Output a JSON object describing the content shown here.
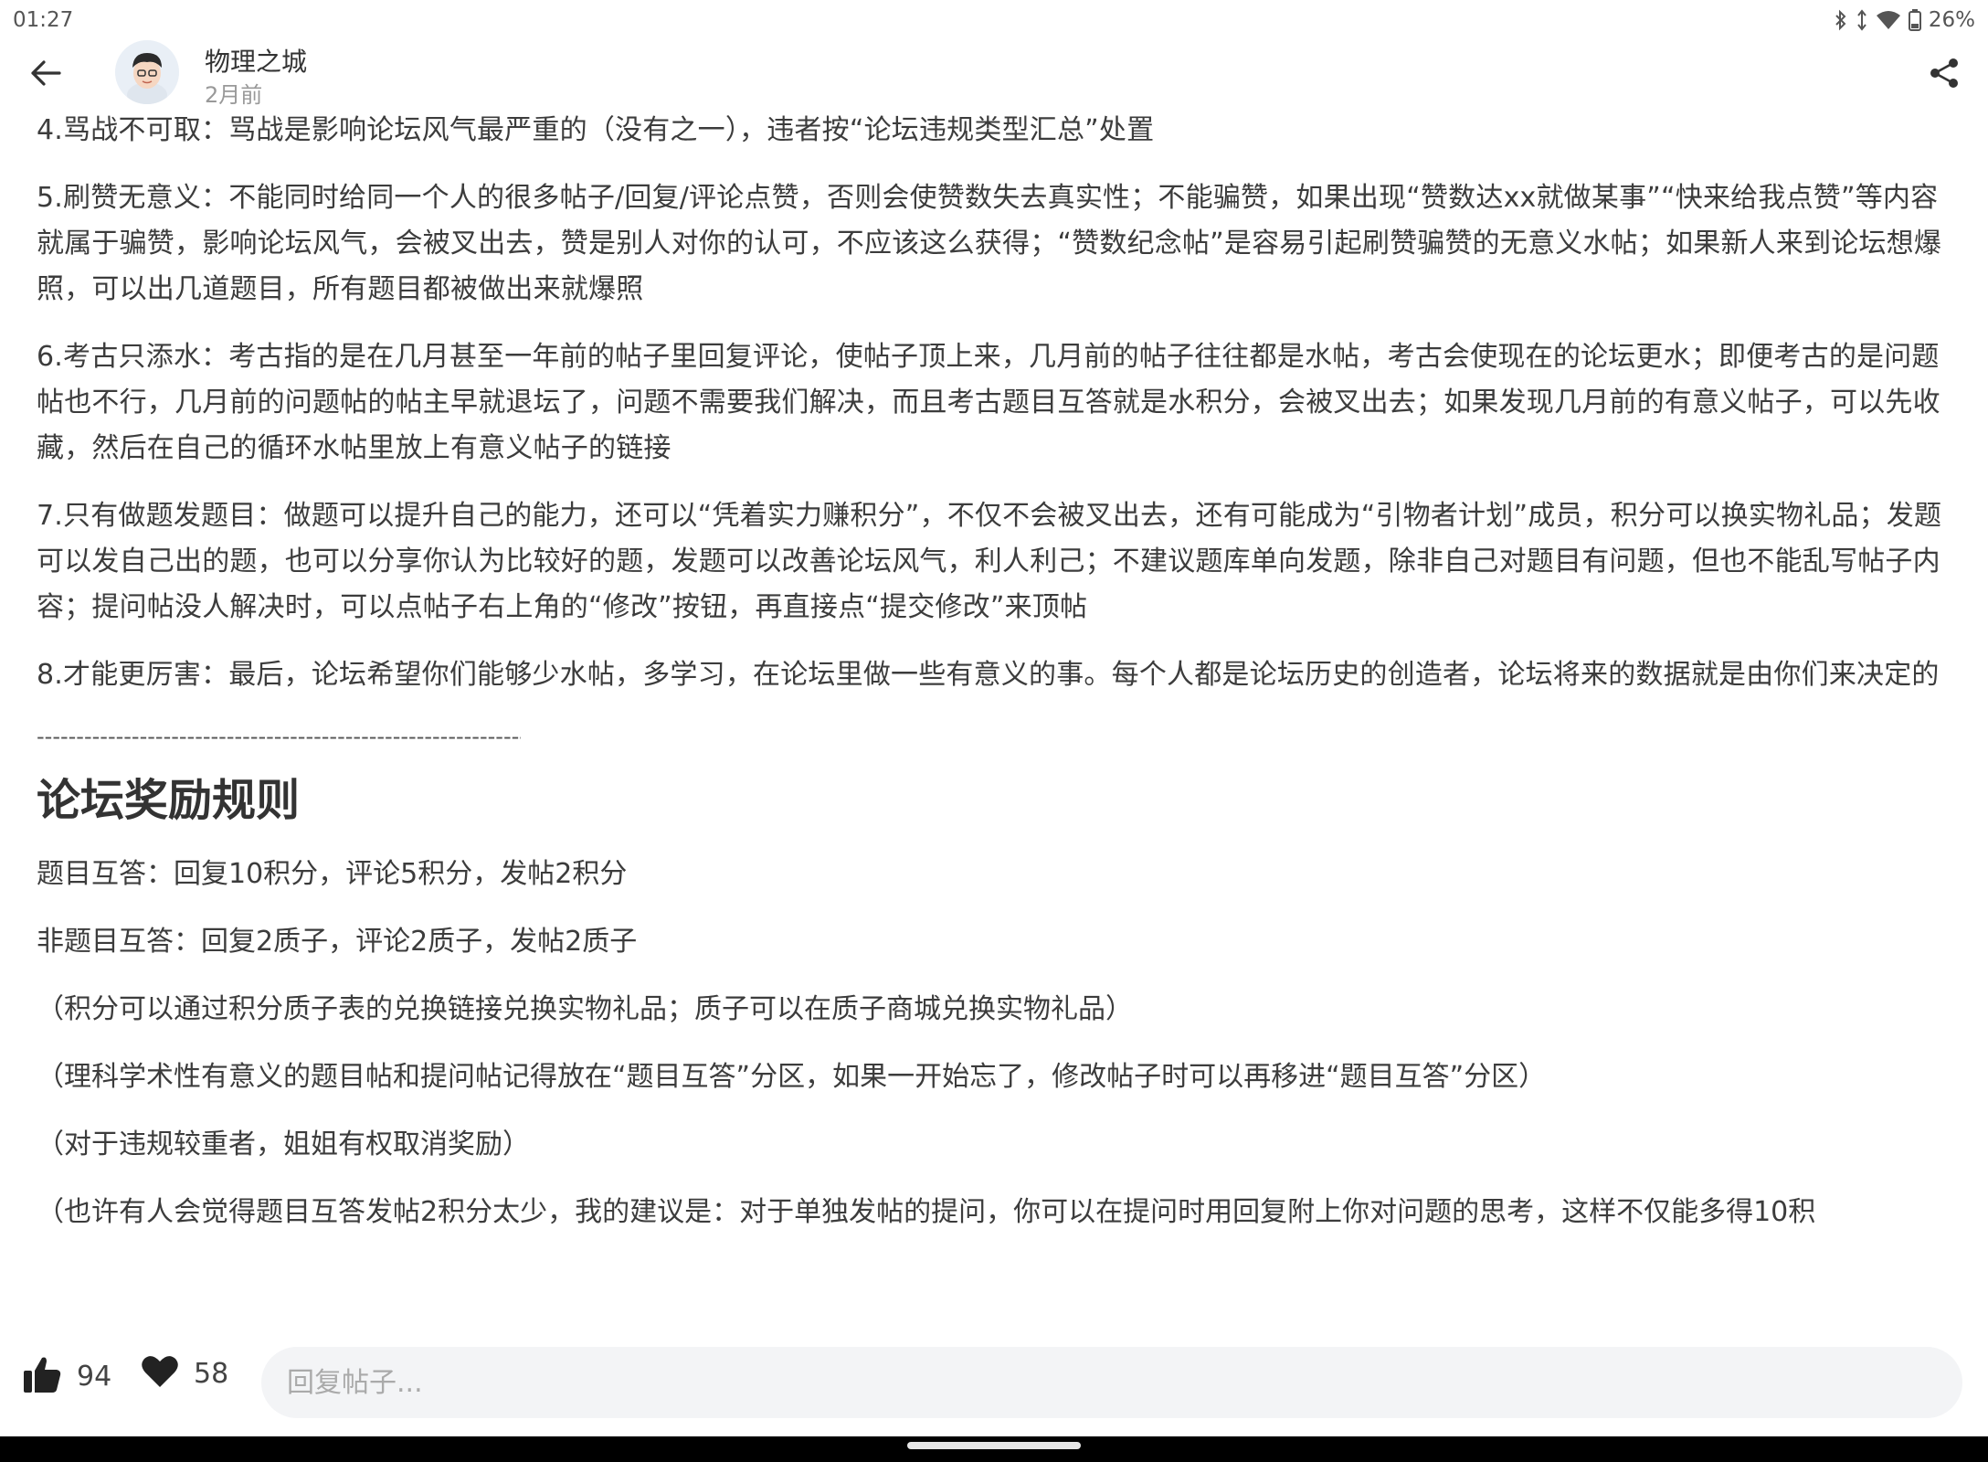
{
  "status_bar": {
    "time": "01:27",
    "battery": "26%"
  },
  "header": {
    "author": "物理之城",
    "time": "2月前"
  },
  "content": {
    "paragraphs": [
      "4.骂战不可取：骂战是影响论坛风气最严重的（没有之一），违者按“论坛违规类型汇总”处置",
      "5.刷赞无意义：不能同时给同一个人的很多帖子/回复/评论点赞，否则会使赞数失去真实性；不能骗赞，如果出现“赞数达xx就做某事”“快来给我点赞”等内容就属于骗赞，影响论坛风气，会被叉出去，赞是别人对你的认可，不应该这么获得；“赞数纪念帖”是容易引起刷赞骗赞的无意义水帖；如果新人来到论坛想爆照，可以出几道题目，所有题目都被做出来就爆照",
      "6.考古只添水：考古指的是在几月甚至一年前的帖子里回复评论，使帖子顶上来，几月前的帖子往往都是水帖，考古会使现在的论坛更水；即便考古的是问题帖也不行，几月前的问题帖的帖主早就退坛了，问题不需要我们解决，而且考古题目互答就是水积分，会被叉出去；如果发现几月前的有意义帖子，可以先收藏，然后在自己的循环水帖里放上有意义帖子的链接",
      "7.只有做题发题目：做题可以提升自己的能力，还可以“凭着实力赚积分”，不仅不会被叉出去，还有可能成为“引物者计划”成员，积分可以换实物礼品；发题可以发自己出的题，也可以分享你认为比较好的题，发题可以改善论坛风气，利人利己；不建议题库单向发题，除非自己对题目有问题，但也不能乱写帖子内容；提问帖没人解决时，可以点帖子右上角的“修改”按钮，再直接点“提交修改”来顶帖",
      "8.才能更厉害：最后，论坛希望你们能够少水帖，多学习，在论坛里做一些有意义的事。每个人都是论坛历史的创造者，论坛将来的数据就是由你们来决定的"
    ],
    "divider": "--------------------------------------------------------------",
    "section_title": "论坛奖励规则",
    "reward_lines": [
      "题目互答：回复10积分，评论5积分，发帖2积分",
      "非题目互答：回复2质子，评论2质子，发帖2质子",
      "（积分可以通过积分质子表的兑换链接兑换实物礼品；质子可以在质子商城兑换实物礼品）",
      "（理科学术性有意义的题目帖和提问帖记得放在“题目互答”分区，如果一开始忘了，修改帖子时可以再移进“题目互答”分区）",
      "（对于违规较重者，姐姐有权取消奖励）",
      "（也许有人会觉得题目互答发帖2积分太少，我的建议是：对于单独发帖的提问，你可以在提问时用回复附上你对问题的思考，这样不仅能多得10积"
    ]
  },
  "bottom_bar": {
    "likes": "94",
    "favorites": "58",
    "reply_placeholder": "回复帖子..."
  }
}
